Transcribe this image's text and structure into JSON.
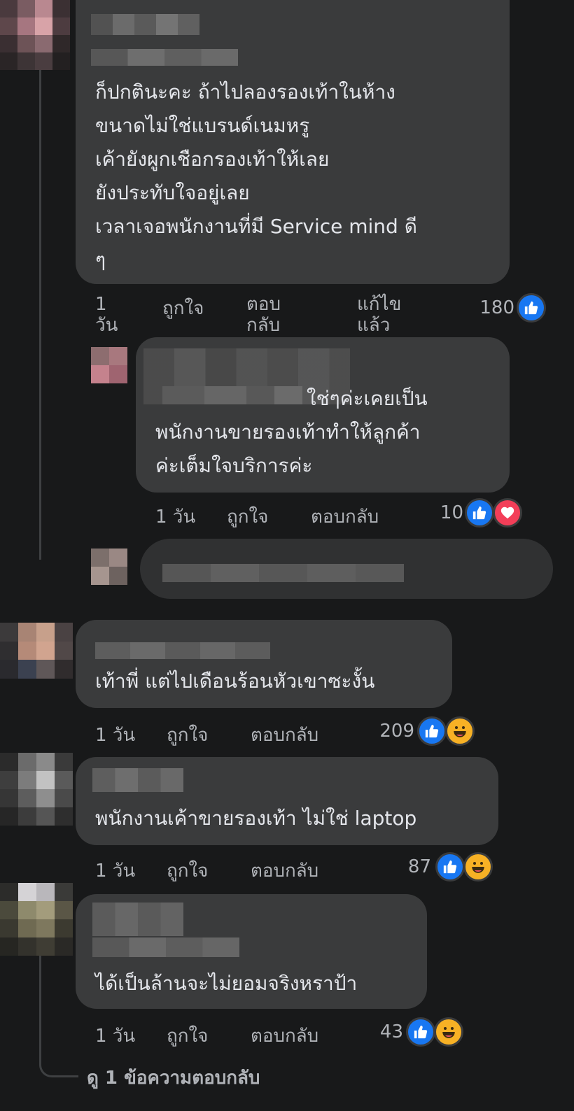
{
  "comments": [
    {
      "lines": [
        "ก็ปกตินะคะ ถ้าไปลองรองเท้าในห้าง",
        "ขนาดไม่ใช่แบรนด์เนมหรู",
        "เค้ายังผูกเชือกรองเท้าให้เลย",
        "ยังประทับใจอยู่เลย",
        "เวลาเจอพนักงานที่มี Service mind ดี",
        "ๆ"
      ],
      "time": "1\nวัน",
      "like": "ถูกใจ",
      "reply": "ตอบ\nกลับ",
      "edited": "แก้ไข\nแล้ว",
      "count": "180",
      "reactions": [
        "like"
      ]
    },
    {
      "lines": [
        "ใช่ๆค่ะเคยเป็น",
        "พนักงานขายรองเท้าทำให้ลูกค้า",
        "ค่ะเต็มใจบริการค่ะ"
      ],
      "time": "1 วัน",
      "like": "ถูกใจ",
      "reply": "ตอบกลับ",
      "count": "10",
      "reactions": [
        "like",
        "love"
      ]
    },
    {
      "lines": [
        "เท้าพี่ แต่ไปเดือนร้อนหัวเขาซะงั้น"
      ],
      "time": "1 วัน",
      "like": "ถูกใจ",
      "reply": "ตอบกลับ",
      "count": "209",
      "reactions": [
        "like",
        "haha"
      ]
    },
    {
      "lines": [
        "พนักงานเค้าขายรองเท้า ไม่ใช่ laptop"
      ],
      "time": "1 วัน",
      "like": "ถูกใจ",
      "reply": "ตอบกลับ",
      "count": "87",
      "reactions": [
        "like",
        "haha"
      ]
    },
    {
      "lines": [
        "ได้เป็นล้านจะไม่ยอมจริงหราป้า"
      ],
      "time": "1 วัน",
      "like": "ถูกใจ",
      "reply": "ตอบกลับ",
      "count": "43",
      "reactions": [
        "like",
        "haha"
      ]
    }
  ],
  "view_replies": "ดู 1 ข้อความตอบกลับ",
  "colors": {
    "background": "#18191a",
    "bubble": "#3a3b3c",
    "text": "#e4e6eb",
    "meta": "#b0b3b8",
    "like": "#1877f2",
    "love": "#f33e58",
    "haha": "#f7b125"
  }
}
